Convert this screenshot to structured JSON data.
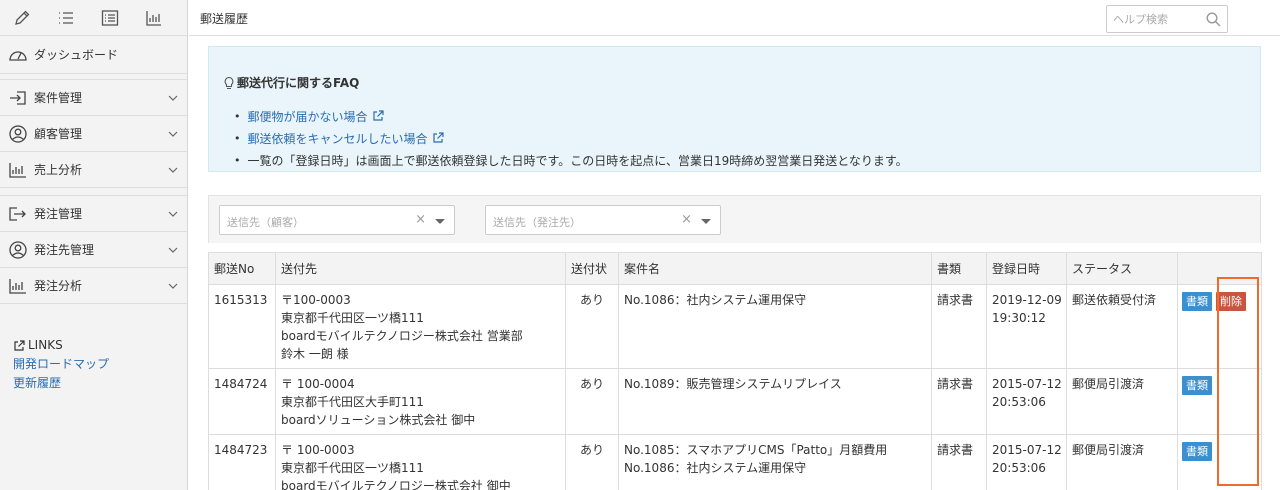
{
  "sidebar": {
    "top_icons": [
      "pencil-icon",
      "list-icon",
      "list-box-icon",
      "bar-chart-icon"
    ],
    "items": [
      {
        "icon": "dashboard-icon",
        "label": "ダッシュボード",
        "chevron": false
      },
      {
        "icon": "sign-in-icon",
        "label": "案件管理",
        "chevron": true
      },
      {
        "icon": "user-circle-icon",
        "label": "顧客管理",
        "chevron": true
      },
      {
        "icon": "bar-chart-icon",
        "label": "売上分析",
        "chevron": true
      },
      {
        "icon": "share-icon",
        "label": "発注管理",
        "chevron": true
      },
      {
        "icon": "user-circle-icon",
        "label": "発注先管理",
        "chevron": true
      },
      {
        "icon": "bar-chart-icon",
        "label": "発注分析",
        "chevron": true
      }
    ],
    "links": {
      "heading": "LINKS",
      "items": [
        "開発ロードマップ",
        "更新履歴"
      ]
    }
  },
  "header": {
    "page_title": "郵送履歴",
    "search_placeholder": "ヘルプ検索"
  },
  "faq": {
    "title": "郵送代行に関するFAQ",
    "link1": "郵便物が届かない場合",
    "link2": "郵送依頼をキャンセルしたい場合",
    "note": "一覧の「登録日時」は画面上で郵送依頼登録した日時です。この日時を起点に、営業日19時締め翌営業日発送となります。"
  },
  "filters": {
    "customer_placeholder": "送信先（顧客）",
    "vendor_placeholder": "送信先（発注先）",
    "clear_symbol": "×"
  },
  "table": {
    "headers": [
      "郵送No",
      "送付先",
      "送付状",
      "案件名",
      "書類",
      "登録日時",
      "ステータス",
      ""
    ],
    "rows": [
      {
        "no": "1615313",
        "recipient": [
          "〒100-0003",
          "東京都千代田区一ツ橋111",
          "boardモバイルテクノロジー株式会社 営業部",
          "鈴木 一朗 様"
        ],
        "cover": "あり",
        "projects": [
          "No.1086：社内システム運用保守"
        ],
        "doc": "請求書",
        "date": "2019-12-09",
        "time": "19:30:12",
        "status": "郵送依頼受付済",
        "doc_button": "書類",
        "delete_button": "削除"
      },
      {
        "no": "1484724",
        "recipient": [
          "〒 100-0004",
          "東京都千代田区大手町111",
          "boardソリューション株式会社 御中"
        ],
        "cover": "あり",
        "projects": [
          "No.1089：販売管理システムリプレイス"
        ],
        "doc": "請求書",
        "date": "2015-07-12",
        "time": "20:53:06",
        "status": "郵便局引渡済",
        "doc_button": "書類"
      },
      {
        "no": "1484723",
        "recipient": [
          "〒 100-0003",
          "東京都千代田区一ツ橋111",
          "boardモバイルテクノロジー株式会社 御中"
        ],
        "cover": "あり",
        "projects": [
          "No.1085：スマホアプリCMS「Patto」月額費用",
          "No.1086：社内システム運用保守"
        ],
        "doc": "請求書",
        "date": "2015-07-12",
        "time": "20:53:06",
        "status": "郵便局引渡済",
        "doc_button": "書類"
      }
    ]
  },
  "colors": {
    "link": "#2a6cb0",
    "doc_button": "#3a8fd0",
    "delete_button": "#c9543f",
    "highlight": "#f06a2c",
    "faq_bg": "#e9f5fb"
  }
}
